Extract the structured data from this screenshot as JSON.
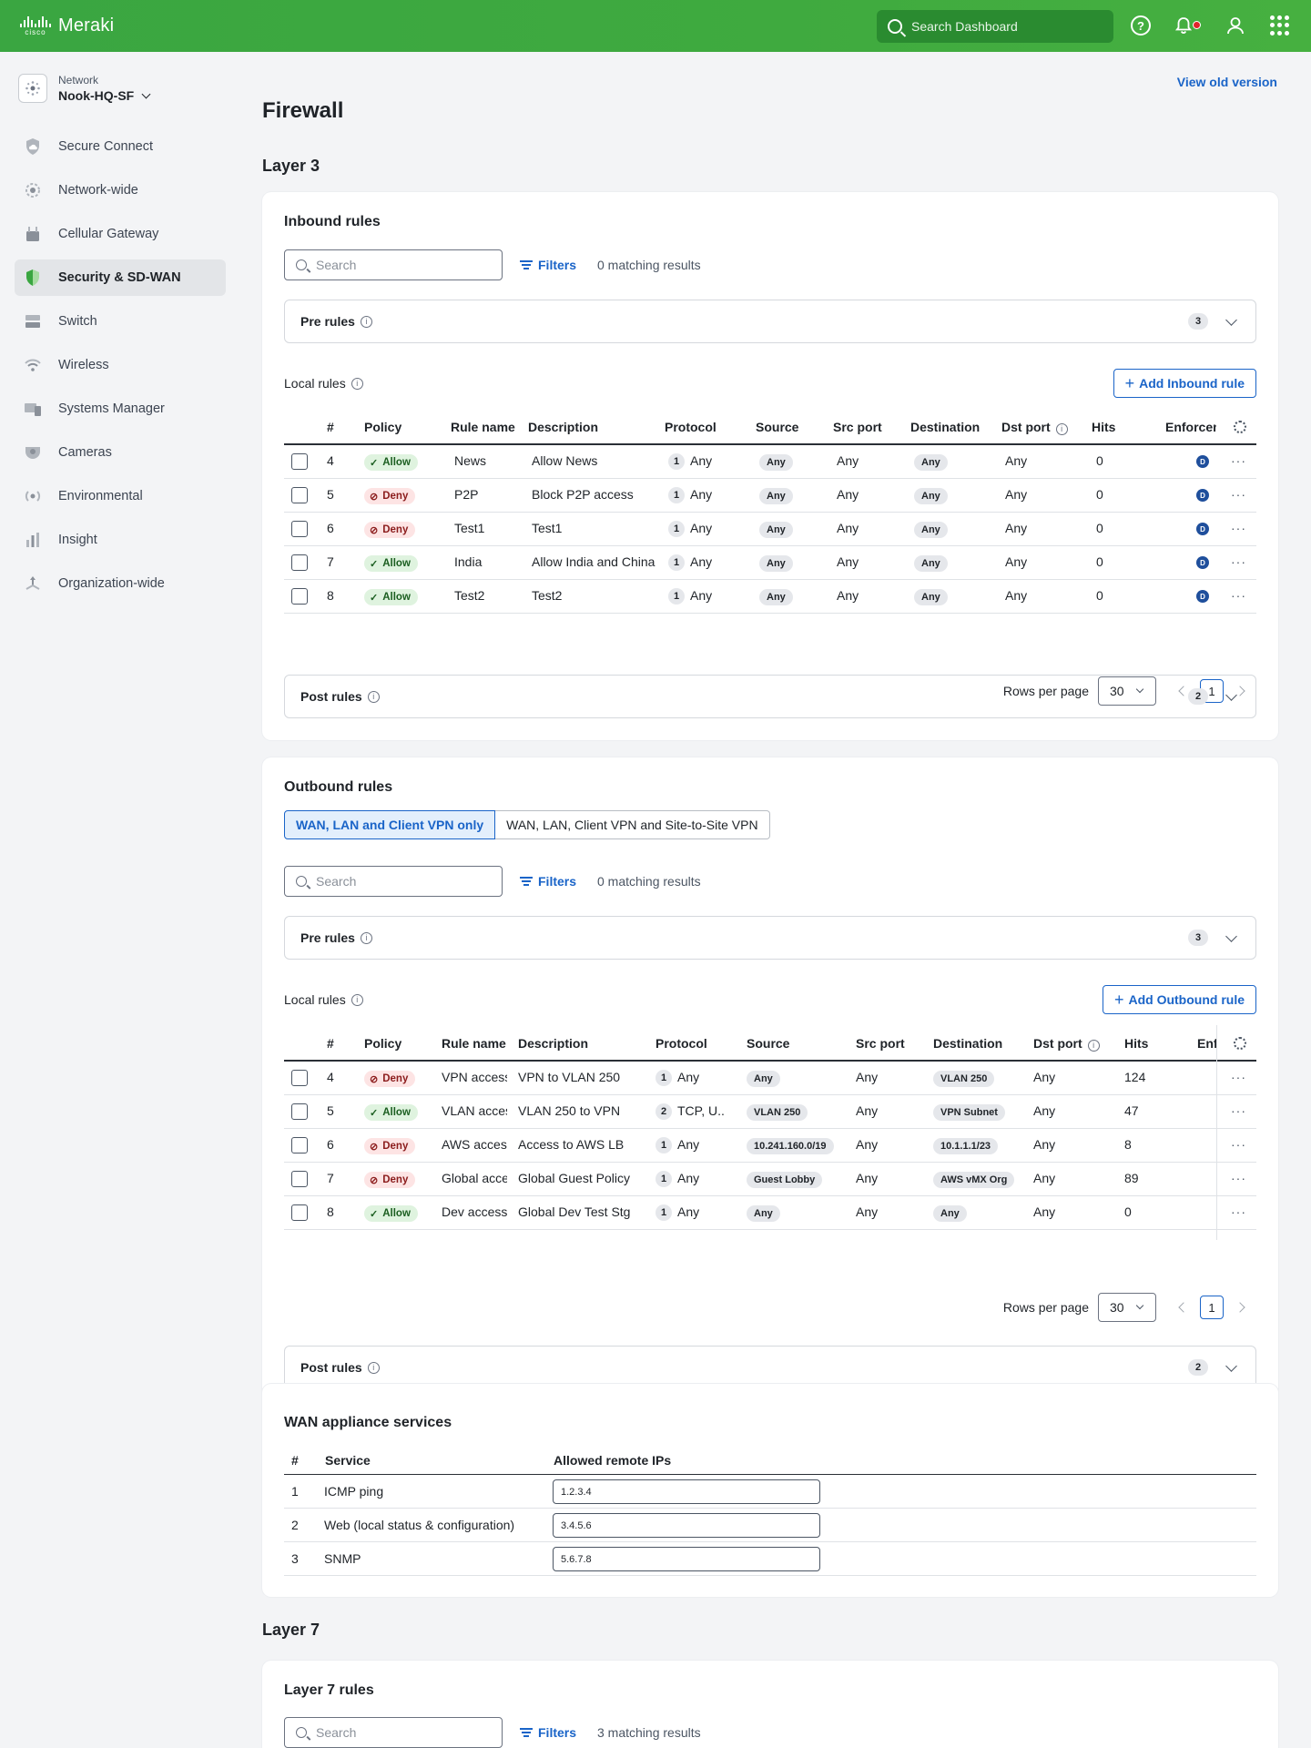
{
  "topbar": {
    "brand_small": "cisco",
    "brand": "Meraki",
    "search_placeholder": "Search Dashboard"
  },
  "sidebar": {
    "network_label": "Network",
    "network_name": "Nook-HQ-SF",
    "items": [
      {
        "label": "Secure Connect",
        "icon": "cloud-shield-icon"
      },
      {
        "label": "Network-wide",
        "icon": "network-gear-icon"
      },
      {
        "label": "Cellular Gateway",
        "icon": "cellular-gateway-icon"
      },
      {
        "label": "Security & SD-WAN",
        "icon": "shield-icon",
        "active": true
      },
      {
        "label": "Switch",
        "icon": "switch-icon"
      },
      {
        "label": "Wireless",
        "icon": "wifi-icon"
      },
      {
        "label": "Systems Manager",
        "icon": "devices-icon"
      },
      {
        "label": "Cameras",
        "icon": "camera-icon"
      },
      {
        "label": "Environmental",
        "icon": "sensor-icon"
      },
      {
        "label": "Insight",
        "icon": "bar-chart-icon"
      },
      {
        "label": "Organization-wide",
        "icon": "org-icon"
      }
    ]
  },
  "main": {
    "view_old": "View old version",
    "title": "Firewall",
    "layer3": "Layer 3",
    "layer7": "Layer 7"
  },
  "inbound": {
    "title": "Inbound rules",
    "search_placeholder": "Search",
    "filters": "Filters",
    "matching": "0 matching results",
    "pre_rules": "Pre rules",
    "pre_count": "3",
    "local_rules": "Local rules",
    "add_button": "Add Inbound rule",
    "columns": [
      "#",
      "Policy",
      "Rule name",
      "Description",
      "Protocol",
      "Source",
      "Src port",
      "Destination",
      "Dst port",
      "Hits",
      "Enforcement"
    ],
    "rows": [
      {
        "num": "4",
        "policy": "Allow",
        "name": "News",
        "desc": "Allow News",
        "proto_n": "1",
        "proto": "Any",
        "src": "Any",
        "srcport": "Any",
        "dst": "Any",
        "dstport": "Any",
        "hits": "0",
        "enf": "D"
      },
      {
        "num": "5",
        "policy": "Deny",
        "name": "P2P",
        "desc": "Block P2P access",
        "proto_n": "1",
        "proto": "Any",
        "src": "Any",
        "srcport": "Any",
        "dst": "Any",
        "dstport": "Any",
        "hits": "0",
        "enf": "D"
      },
      {
        "num": "6",
        "policy": "Deny",
        "name": "Test1",
        "desc": "Test1",
        "proto_n": "1",
        "proto": "Any",
        "src": "Any",
        "srcport": "Any",
        "dst": "Any",
        "dstport": "Any",
        "hits": "0",
        "enf": "D"
      },
      {
        "num": "7",
        "policy": "Allow",
        "name": "India",
        "desc": "Allow India and China",
        "proto_n": "1",
        "proto": "Any",
        "src": "Any",
        "srcport": "Any",
        "dst": "Any",
        "dstport": "Any",
        "hits": "0",
        "enf": "D"
      },
      {
        "num": "8",
        "policy": "Allow",
        "name": "Test2",
        "desc": "Test2",
        "proto_n": "1",
        "proto": "Any",
        "src": "Any",
        "srcport": "Any",
        "dst": "Any",
        "dstport": "Any",
        "hits": "0",
        "enf": "D"
      }
    ],
    "rows_per_page_label": "Rows per page",
    "rows_per_page": "30",
    "page": "1",
    "post_rules": "Post rules",
    "post_count": "2"
  },
  "outbound": {
    "title": "Outbound rules",
    "tabs": [
      "WAN, LAN and Client VPN only",
      "WAN, LAN, Client VPN and Site-to-Site VPN"
    ],
    "search_placeholder": "Search",
    "filters": "Filters",
    "matching": "0 matching results",
    "pre_rules": "Pre rules",
    "pre_count": "3",
    "local_rules": "Local rules",
    "add_button": "Add Outbound rule",
    "columns": [
      "#",
      "Policy",
      "Rule name",
      "Description",
      "Protocol",
      "Source",
      "Src port",
      "Destination",
      "Dst port",
      "Hits",
      "Enforcement"
    ],
    "rows": [
      {
        "num": "4",
        "policy": "Deny",
        "name": "VPN access",
        "desc": "VPN to VLAN 250",
        "proto_n": "1",
        "proto": "Any",
        "src": "Any",
        "srcport": "Any",
        "dst": "VLAN 250",
        "dstport": "Any",
        "hits": "124"
      },
      {
        "num": "5",
        "policy": "Allow",
        "name": "VLAN access",
        "desc": "VLAN 250 to VPN",
        "proto_n": "2",
        "proto": "TCP, U..",
        "src": "VLAN 250",
        "srcport": "Any",
        "dst": "VPN Subnet",
        "dstport": "Any",
        "hits": "47"
      },
      {
        "num": "6",
        "policy": "Deny",
        "name": "AWS access",
        "desc": "Access to AWS LB",
        "proto_n": "1",
        "proto": "Any",
        "src": "10.241.160.0/19",
        "srcport": "Any",
        "dst": "10.1.1.1/23",
        "dstport": "Any",
        "hits": "8"
      },
      {
        "num": "7",
        "policy": "Deny",
        "name": "Global access",
        "desc": "Global Guest Policy",
        "proto_n": "1",
        "proto": "Any",
        "src": "Guest Lobby",
        "srcport": "Any",
        "dst": "AWS vMX Org",
        "dstport": "Any",
        "hits": "89"
      },
      {
        "num": "8",
        "policy": "Allow",
        "name": "Dev access",
        "desc": "Global Dev Test Stg",
        "proto_n": "1",
        "proto": "Any",
        "src": "Any",
        "srcport": "Any",
        "dst": "Any",
        "dstport": "Any",
        "hits": "0"
      }
    ],
    "rows_per_page_label": "Rows per page",
    "rows_per_page": "30",
    "page": "1",
    "post_rules": "Post rules",
    "post_count": "2"
  },
  "wan": {
    "title": "WAN appliance services",
    "columns": [
      "#",
      "Service",
      "Allowed remote IPs"
    ],
    "rows": [
      {
        "num": "1",
        "service": "ICMP ping",
        "ips": "1.2.3.4"
      },
      {
        "num": "2",
        "service": "Web (local status & configuration)",
        "ips": "3.4.5.6"
      },
      {
        "num": "3",
        "service": "SNMP",
        "ips": "5.6.7.8"
      }
    ]
  },
  "layer7": {
    "title": "Layer 7 rules",
    "search_placeholder": "Search",
    "filters": "Filters",
    "matching": "3 matching results"
  }
}
